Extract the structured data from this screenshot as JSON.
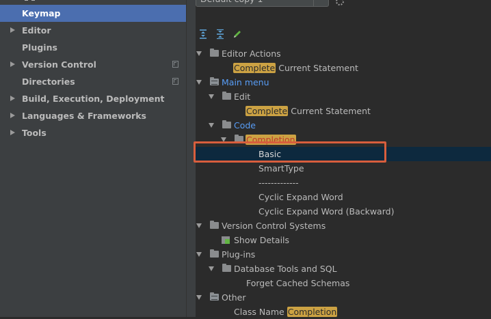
{
  "sidebar": {
    "items": [
      {
        "label": "Keymap",
        "selected": true,
        "expandable": false,
        "copy": false
      },
      {
        "label": "Editor",
        "selected": false,
        "expandable": true,
        "copy": false
      },
      {
        "label": "Plugins",
        "selected": false,
        "expandable": false,
        "copy": false
      },
      {
        "label": "Version Control",
        "selected": false,
        "expandable": true,
        "copy": true
      },
      {
        "label": "Directories",
        "selected": false,
        "expandable": false,
        "copy": true
      },
      {
        "label": "Build, Execution, Deployment",
        "selected": false,
        "expandable": true,
        "copy": false
      },
      {
        "label": "Languages & Frameworks",
        "selected": false,
        "expandable": true,
        "copy": false
      },
      {
        "label": "Tools",
        "selected": false,
        "expandable": true,
        "copy": false
      }
    ]
  },
  "keymap_combo": {
    "value": "Default copy 1"
  },
  "toolbar": {
    "icons": [
      "expand-all-icon",
      "collapse-all-icon",
      "edit-pencil-icon"
    ]
  },
  "tree": {
    "rows": [
      {
        "text": "Editor Actions",
        "kind": "folder",
        "icon": "editor-actions-folder-icon"
      },
      {
        "hl": "Complete",
        "text": " Current Statement",
        "kind": "action"
      },
      {
        "text": "Main menu",
        "kind": "menu-folder",
        "link": true
      },
      {
        "text": "Edit",
        "kind": "folder"
      },
      {
        "hl": "Complete",
        "text": " Current Statement",
        "kind": "action"
      },
      {
        "text": "Code",
        "kind": "folder",
        "link": true
      },
      {
        "hl": "Completion",
        "text": "",
        "kind": "folder",
        "hl_red": true
      },
      {
        "text": "Basic",
        "kind": "action",
        "selected": true
      },
      {
        "text": "SmartType",
        "kind": "action"
      },
      {
        "text": "-------------",
        "kind": "separator"
      },
      {
        "text": "Cyclic Expand Word",
        "kind": "action"
      },
      {
        "text": "Cyclic Expand Word (Backward)",
        "kind": "action"
      },
      {
        "text": "Version Control Systems",
        "kind": "folder"
      },
      {
        "text": "Show Details",
        "kind": "action-icon"
      },
      {
        "text": "Plug-ins",
        "kind": "folder"
      },
      {
        "text": "Database Tools and SQL",
        "kind": "folder"
      },
      {
        "text": "Forget Cached Schemas",
        "kind": "action"
      },
      {
        "text": "Other",
        "kind": "menu-folder"
      },
      {
        "text": "Class Name ",
        "hl": "Completion",
        "hl_after": true,
        "kind": "action"
      }
    ]
  },
  "colors": {
    "selection": "#4b6eaf",
    "tree_selection": "#0d293e",
    "search_highlight": "#cca243",
    "annotation": "#d85e3d",
    "link": "#589df6"
  }
}
